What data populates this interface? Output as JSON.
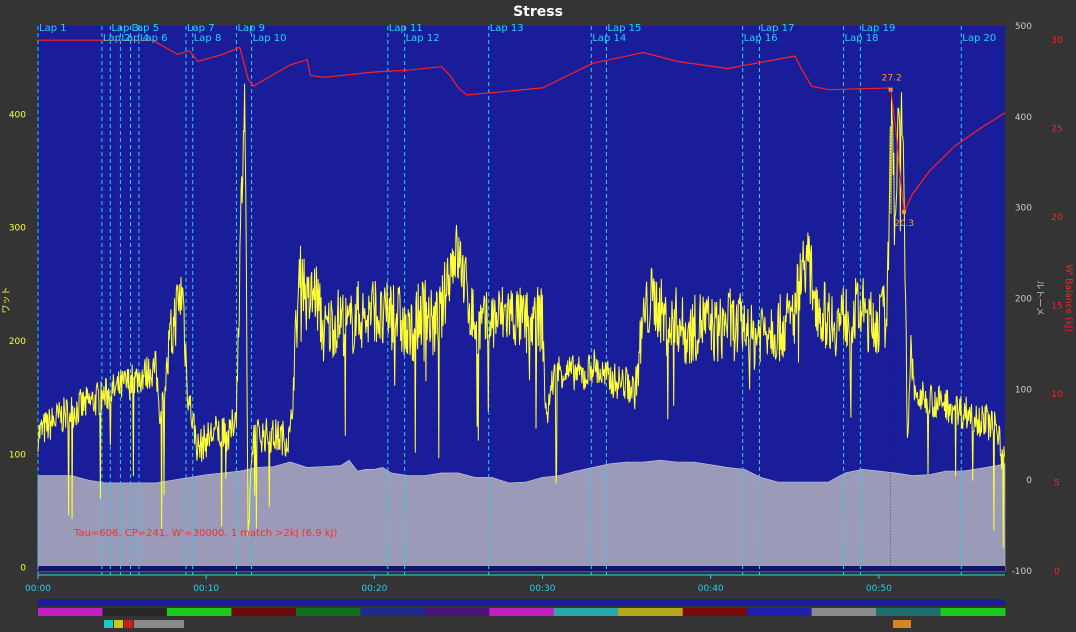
{
  "chart_data": {
    "type": "line",
    "title": "Stress",
    "x": {
      "unit": "min",
      "range": [
        0,
        57.5
      ],
      "tick_values": [
        0,
        10,
        20,
        30,
        40,
        50
      ],
      "tick_labels": [
        "00:00",
        "00:10",
        "00:20",
        "00:30",
        "00:40",
        "00:50"
      ]
    },
    "y_left": {
      "label": "ワット",
      "range": [
        -3,
        478
      ],
      "ticks": [
        0,
        100,
        200,
        300,
        400
      ],
      "color": "#ffff33"
    },
    "y_right1": {
      "label": "ルトーメ",
      "range": [
        -100,
        500
      ],
      "ticks": [
        -100,
        0,
        100,
        200,
        300,
        400,
        500
      ],
      "color": "#bbbbbb"
    },
    "y_right2": {
      "label": "W' Balance (kJ)",
      "range": [
        0,
        30.8
      ],
      "ticks": [
        0,
        5,
        10,
        15,
        20,
        25,
        30
      ],
      "color": "#ff2020"
    },
    "laps": [
      {
        "label": "Lap 1",
        "t": 0.0
      },
      {
        "label": "Lap 2",
        "t": 3.8
      },
      {
        "label": "Lap 3",
        "t": 4.3
      },
      {
        "label": "Lap 4",
        "t": 4.9
      },
      {
        "label": "Lap 5",
        "t": 5.5
      },
      {
        "label": "Lap 6",
        "t": 6.0
      },
      {
        "label": "Lap 7",
        "t": 8.8
      },
      {
        "label": "Lap 8",
        "t": 9.2
      },
      {
        "label": "Lap 9",
        "t": 11.8
      },
      {
        "label": "Lap 10",
        "t": 12.7
      },
      {
        "label": "Lap 11",
        "t": 20.8
      },
      {
        "label": "Lap 12",
        "t": 21.8
      },
      {
        "label": "Lap 13",
        "t": 26.8
      },
      {
        "label": "Lap 14",
        "t": 32.9
      },
      {
        "label": "Lap 15",
        "t": 33.8
      },
      {
        "label": "Lap 16",
        "t": 41.9
      },
      {
        "label": "Lap 17",
        "t": 42.9
      },
      {
        "label": "Lap 18",
        "t": 47.9
      },
      {
        "label": "Lap 19",
        "t": 48.9
      },
      {
        "label": "Lap 20",
        "t": 54.9
      }
    ],
    "series": [
      {
        "name": "ワット",
        "color": "#ffff33",
        "points": [
          [
            0,
            118
          ],
          [
            1,
            130
          ],
          [
            2,
            138
          ],
          [
            3,
            145
          ],
          [
            4,
            152
          ],
          [
            5,
            160
          ],
          [
            6,
            168
          ],
          [
            7,
            176
          ],
          [
            7.3,
            132
          ],
          [
            7.8,
            190
          ],
          [
            8.2,
            225
          ],
          [
            8.6,
            245
          ],
          [
            8.9,
            155
          ],
          [
            9.5,
            105
          ],
          [
            10.5,
            120
          ],
          [
            11.4,
            115
          ],
          [
            11.8,
            140
          ],
          [
            12.1,
            330
          ],
          [
            12.3,
            425
          ],
          [
            12.5,
            20
          ],
          [
            12.8,
            118
          ],
          [
            14.0,
            116
          ],
          [
            15.0,
            114
          ],
          [
            15.2,
            165
          ],
          [
            15.6,
            275
          ],
          [
            16.0,
            230
          ],
          [
            16.5,
            245
          ],
          [
            17.0,
            205
          ],
          [
            17.5,
            215
          ],
          [
            18.0,
            220
          ],
          [
            18.5,
            210
          ],
          [
            19.0,
            225
          ],
          [
            19.5,
            218
          ],
          [
            20.0,
            230
          ],
          [
            20.5,
            215
          ],
          [
            21.0,
            230
          ],
          [
            21.5,
            220
          ],
          [
            22.0,
            200
          ],
          [
            22.5,
            218
          ],
          [
            23.0,
            230
          ],
          [
            23.5,
            212
          ],
          [
            24.0,
            225
          ],
          [
            24.4,
            260
          ],
          [
            24.8,
            280
          ],
          [
            25.2,
            265
          ],
          [
            25.6,
            235
          ],
          [
            26.0,
            215
          ],
          [
            26.5,
            212
          ],
          [
            27,
            218
          ],
          [
            28,
            225
          ],
          [
            29,
            215
          ],
          [
            30,
            220
          ],
          [
            30.2,
            130
          ],
          [
            30.6,
            165
          ],
          [
            31.0,
            175
          ],
          [
            31.5,
            172
          ],
          [
            32,
            172
          ],
          [
            32.5,
            168
          ],
          [
            33,
            180
          ],
          [
            33.5,
            170
          ],
          [
            34,
            166
          ],
          [
            35,
            162
          ],
          [
            35.5,
            155
          ],
          [
            36,
            218
          ],
          [
            36.5,
            238
          ],
          [
            37,
            228
          ],
          [
            37.5,
            210
          ],
          [
            38,
            220
          ],
          [
            38.5,
            205
          ],
          [
            39,
            210
          ],
          [
            39.5,
            218
          ],
          [
            40,
            212
          ],
          [
            40.5,
            208
          ],
          [
            41,
            220
          ],
          [
            41.5,
            210
          ],
          [
            42,
            215
          ],
          [
            42.5,
            200
          ],
          [
            43,
            212
          ],
          [
            43.5,
            215
          ],
          [
            44,
            210
          ],
          [
            44.5,
            215
          ],
          [
            45,
            225
          ],
          [
            45.3,
            258
          ],
          [
            45.7,
            275
          ],
          [
            46.0,
            255
          ],
          [
            46.5,
            225
          ],
          [
            47,
            222
          ],
          [
            47.5,
            215
          ],
          [
            48,
            222
          ],
          [
            48.5,
            225
          ],
          [
            49,
            228
          ],
          [
            49.5,
            215
          ],
          [
            50,
            218
          ],
          [
            50.5,
            225
          ],
          [
            50.7,
            400
          ],
          [
            50.9,
            360
          ],
          [
            51.0,
            315
          ],
          [
            51.2,
            425
          ],
          [
            51.4,
            380
          ],
          [
            51.5,
            320
          ],
          [
            51.7,
            110
          ],
          [
            51.9,
            190
          ],
          [
            52.1,
            155
          ],
          [
            52.5,
            148
          ],
          [
            53,
            150
          ],
          [
            53.5,
            145
          ],
          [
            54,
            145
          ],
          [
            54.5,
            140
          ],
          [
            55,
            138
          ],
          [
            55.5,
            135
          ],
          [
            56,
            132
          ],
          [
            56.5,
            128
          ],
          [
            57.0,
            124
          ],
          [
            57.2,
            118
          ],
          [
            57.3,
            100
          ],
          [
            57.5,
            110
          ]
        ]
      },
      {
        "name": "ルトーメ",
        "color": "#9b9ab8",
        "points": [
          [
            0,
            5
          ],
          [
            1,
            5
          ],
          [
            2,
            5
          ],
          [
            3,
            0
          ],
          [
            4,
            -3
          ],
          [
            5,
            -3
          ],
          [
            6,
            -3
          ],
          [
            7,
            -3
          ],
          [
            8,
            0
          ],
          [
            9,
            3
          ],
          [
            10,
            6
          ],
          [
            11,
            8
          ],
          [
            12,
            10
          ],
          [
            13,
            14
          ],
          [
            14,
            15
          ],
          [
            15,
            20
          ],
          [
            16,
            14
          ],
          [
            17,
            15
          ],
          [
            18,
            16
          ],
          [
            18.5,
            22
          ],
          [
            19,
            10
          ],
          [
            19.5,
            12
          ],
          [
            20,
            12
          ],
          [
            20.5,
            14
          ],
          [
            21,
            8
          ],
          [
            22,
            5
          ],
          [
            23,
            5
          ],
          [
            24,
            8
          ],
          [
            25,
            8
          ],
          [
            26,
            3
          ],
          [
            27,
            3
          ],
          [
            28,
            -3
          ],
          [
            29,
            -2
          ],
          [
            30,
            3
          ],
          [
            31,
            5
          ],
          [
            32,
            10
          ],
          [
            33,
            14
          ],
          [
            34,
            18
          ],
          [
            35,
            20
          ],
          [
            36,
            20
          ],
          [
            37,
            22
          ],
          [
            38,
            20
          ],
          [
            39,
            20
          ],
          [
            40,
            17
          ],
          [
            41,
            14
          ],
          [
            42,
            12
          ],
          [
            43,
            3
          ],
          [
            44,
            -2
          ],
          [
            45,
            -2
          ],
          [
            46,
            -2
          ],
          [
            47,
            -2
          ],
          [
            48,
            8
          ],
          [
            49,
            12
          ],
          [
            50,
            10
          ],
          [
            51,
            8
          ],
          [
            52,
            5
          ],
          [
            53,
            6
          ],
          [
            54,
            10
          ],
          [
            55,
            10
          ],
          [
            56,
            13
          ],
          [
            57,
            16
          ],
          [
            57.5,
            18
          ]
        ]
      },
      {
        "name": "W' Balance (kJ)",
        "color": "#ff2020",
        "points": [
          [
            0,
            30
          ],
          [
            6.8,
            30
          ],
          [
            8.3,
            29.2
          ],
          [
            9.0,
            29.4
          ],
          [
            9.5,
            28.8
          ],
          [
            11.0,
            29.2
          ],
          [
            12.0,
            29.6
          ],
          [
            12.5,
            27.8
          ],
          [
            12.8,
            27.4
          ],
          [
            15.0,
            28.6
          ],
          [
            16.0,
            28.9
          ],
          [
            16.2,
            28.0
          ],
          [
            17.0,
            27.9
          ],
          [
            20.0,
            28.2
          ],
          [
            22.0,
            28.3
          ],
          [
            24.0,
            28.5
          ],
          [
            24.5,
            28.0
          ],
          [
            25.0,
            27.3
          ],
          [
            25.5,
            26.9
          ],
          [
            30.0,
            27.3
          ],
          [
            33.0,
            28.7
          ],
          [
            36.0,
            29.3
          ],
          [
            38.0,
            28.8
          ],
          [
            41.0,
            28.4
          ],
          [
            45.0,
            29.1
          ],
          [
            45.5,
            28.2
          ],
          [
            46.0,
            27.4
          ],
          [
            47.0,
            27.2
          ],
          [
            50.7,
            27.3
          ],
          [
            51.0,
            25.0
          ],
          [
            51.3,
            22.0
          ],
          [
            51.5,
            20.3
          ],
          [
            52.0,
            21.3
          ],
          [
            53.0,
            22.6
          ],
          [
            54.5,
            24.0
          ],
          [
            56.0,
            25.0
          ],
          [
            57.5,
            25.9
          ]
        ]
      }
    ],
    "markers": [
      {
        "t": 50.7,
        "value": 27.2,
        "label": "27.2"
      },
      {
        "t": 51.5,
        "value": 20.3,
        "label": "20.3"
      }
    ],
    "annotation": "Tau=606, CP=241, W'=30000, 1 match >2kJ (6.9 kJ)",
    "grid": false,
    "legend": "none",
    "colors": {
      "background": "#343434",
      "plot": "#1a1d99",
      "lap_lines": "#22d3f0",
      "annotation": "#ff2a2a",
      "marker": "#ff9a2a"
    },
    "zone_bar_colors": [
      "#c21fc2",
      "#262626",
      "#1ec91e",
      "#6b0a0a",
      "#0e6e1e",
      "#1e2a8c",
      "#4a1478",
      "#c21fc2",
      "#2aa8a8",
      "#b6a81e",
      "#7a0a0a",
      "#2020b0",
      "#8a8a8a",
      "#1e6e6e",
      "#1ec91e"
    ],
    "secondary_bar_colors": [
      "#1ec9c9",
      "#c9c91e",
      "#c91e1e",
      "#8a8a8a",
      "#d6861e"
    ]
  }
}
